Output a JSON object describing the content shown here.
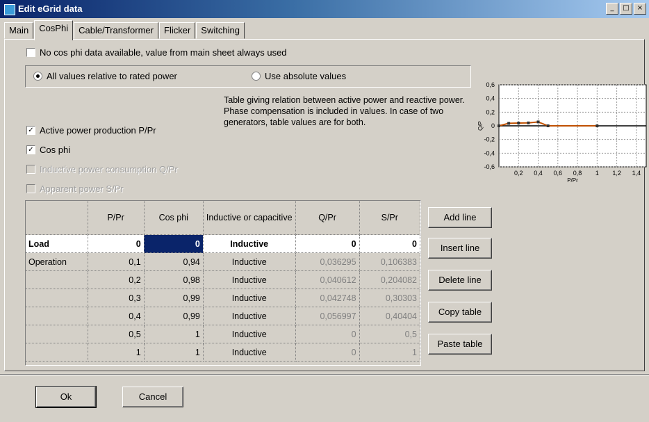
{
  "window": {
    "title": "Edit eGrid data",
    "controls": [
      "_",
      "□",
      "×"
    ]
  },
  "tabs": [
    "Main",
    "CosPhi",
    "Cable/Transformer",
    "Flicker",
    "Switching"
  ],
  "options": {
    "no_cosphi_label": "No cos phi data available, value from main sheet always used",
    "relative_label": "All values relative to rated power",
    "absolute_label": "Use absolute values",
    "active_power_label": "Active power production P/Pr",
    "cos_phi_label": "Cos phi",
    "inductive_label": "Inductive power consumption Q/Pr",
    "apparent_label": "Apparent power S/Pr"
  },
  "description": "Table giving relation between active power and reactive power. Phase compensation is included in values. In case of two generators, table values are for both.",
  "table": {
    "headers": [
      "",
      "P/Pr",
      "Cos phi",
      "Inductive or capacitive",
      "Q/Pr",
      "S/Pr"
    ],
    "rows": [
      [
        "Load",
        "0",
        "0",
        "Inductive",
        "0",
        "0"
      ],
      [
        "Operation",
        "0,1",
        "0,94",
        "Inductive",
        "0,036295",
        "0,106383"
      ],
      [
        "",
        "0,2",
        "0,98",
        "Inductive",
        "0,040612",
        "0,204082"
      ],
      [
        "",
        "0,3",
        "0,99",
        "Inductive",
        "0,042748",
        "0,30303"
      ],
      [
        "",
        "0,4",
        "0,99",
        "Inductive",
        "0,056997",
        "0,40404"
      ],
      [
        "",
        "0,5",
        "1",
        "Inductive",
        "0",
        "0,5"
      ],
      [
        "",
        "1",
        "1",
        "Inductive",
        "0",
        "1"
      ]
    ]
  },
  "side_buttons": {
    "add": "Add line",
    "insert": "Insert line",
    "delete": "Delete line",
    "copy": "Copy table",
    "paste": "Paste table"
  },
  "buttons": {
    "ok": "Ok",
    "cancel": "Cancel"
  },
  "chart_data": {
    "type": "line",
    "xlabel": "P/Pr",
    "ylabel": "Q/P",
    "xticks": [
      "0,2",
      "0,4",
      "0,6",
      "0,8",
      "1",
      "1,2",
      "1,4"
    ],
    "yticks": [
      "0,6",
      "0,4",
      "0,2",
      "0",
      "-0,2",
      "-0,4",
      "-0,6"
    ],
    "xlim": [
      0,
      1.5
    ],
    "ylim": [
      -0.6,
      0.6
    ],
    "grid": true,
    "series": [
      {
        "x": [
          0,
          0.1,
          0.2,
          0.3,
          0.4,
          0.5,
          1
        ],
        "y": [
          0,
          0.036295,
          0.040612,
          0.042748,
          0.056997,
          0,
          0
        ],
        "color": "#c05000"
      }
    ]
  }
}
